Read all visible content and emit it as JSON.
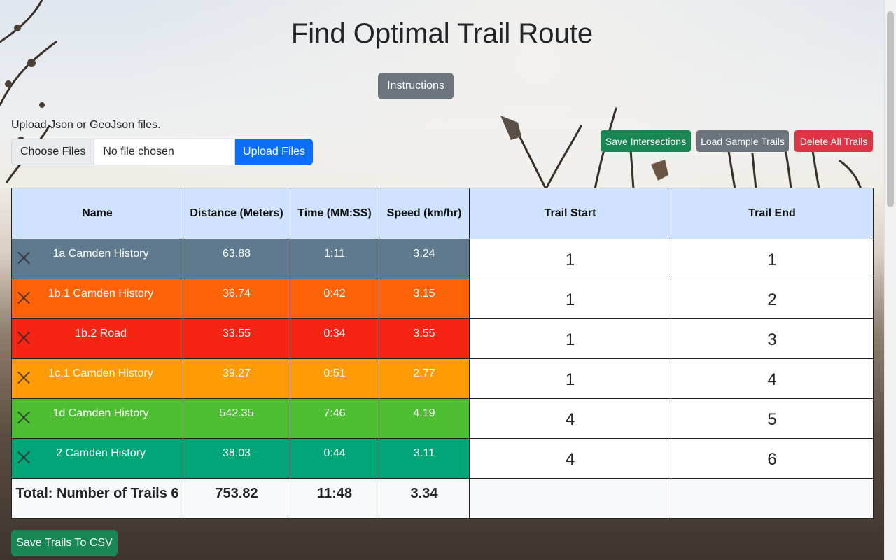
{
  "page": {
    "title": "Find Optimal Trail Route",
    "instructions_label": "Instructions"
  },
  "upload": {
    "label": "Upload Json or GeoJson files.",
    "choose_label": "Choose Files",
    "status": "No file chosen",
    "upload_button": "Upload Files"
  },
  "actions": {
    "save_intersections": "Save Intersections",
    "load_sample": "Load Sample Trails",
    "delete_all": "Delete All Trails",
    "save_csv": "Save Trails To CSV"
  },
  "table": {
    "headers": [
      "Name",
      "Distance (Meters)",
      "Time (MM:SS)",
      "Speed (km/hr)",
      "Trail Start",
      "Trail End"
    ],
    "rows": [
      {
        "name": "1a Camden History",
        "distance": "63.88",
        "time": "1:11",
        "speed": "3.24",
        "start": "1",
        "end": "1",
        "color": "#5f7a8e"
      },
      {
        "name": "1b.1 Camden History",
        "distance": "36.74",
        "time": "0:42",
        "speed": "3.15",
        "start": "1",
        "end": "2",
        "color": "#ff6207"
      },
      {
        "name": "1b.2 Road",
        "distance": "33.55",
        "time": "0:34",
        "speed": "3.55",
        "start": "1",
        "end": "3",
        "color": "#f52413"
      },
      {
        "name": "1c.1 Camden History",
        "distance": "39.27",
        "time": "0:51",
        "speed": "2.77",
        "start": "1",
        "end": "4",
        "color": "#ff9b05"
      },
      {
        "name": "1d Camden History",
        "distance": "542.35",
        "time": "7:46",
        "speed": "4.19",
        "start": "4",
        "end": "5",
        "color": "#4ebe32"
      },
      {
        "name": "2 Camden History",
        "distance": "38.03",
        "time": "0:44",
        "speed": "3.11",
        "start": "4",
        "end": "6",
        "color": "#00a578"
      }
    ],
    "total": {
      "label": "Total: Number of Trails 6",
      "distance": "753.82",
      "time": "11:48",
      "speed": "3.34"
    }
  }
}
